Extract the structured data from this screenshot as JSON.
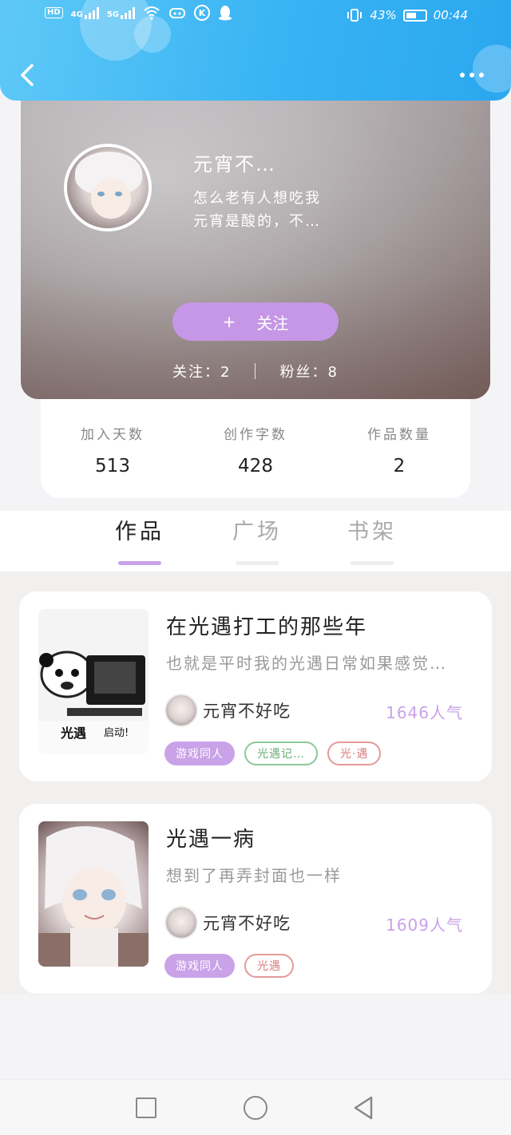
{
  "status_bar": {
    "left_tags": [
      "HD",
      "4G",
      "5G"
    ],
    "battery": "43%",
    "time": "00:44"
  },
  "header": {
    "back_icon": "chevron-left-icon",
    "more_icon": "more-horizontal-icon"
  },
  "profile": {
    "name": "元宵不…",
    "bio_line1": "怎么老有人想吃我",
    "bio_line2": "元宵是酸的，不…",
    "follow_plus": "+",
    "follow_label": "关注",
    "following_text": "关注：2",
    "fans_text": "粉丝：8"
  },
  "stats": [
    {
      "label": "加入天数",
      "value": "513"
    },
    {
      "label": "创作字数",
      "value": "428"
    },
    {
      "label": "作品数量",
      "value": "2"
    }
  ],
  "tabs": [
    {
      "label": "作品",
      "active": true
    },
    {
      "label": "广场",
      "active": false
    },
    {
      "label": "书架",
      "active": false
    }
  ],
  "works": [
    {
      "title": "在光遇打工的那些年",
      "desc": "也就是平时我的光遇日常如果感觉…",
      "author": "元宵不好吃",
      "popularity": "1646人气",
      "cover_text_left": "光遇",
      "cover_text_right": "启动!",
      "tags": [
        {
          "label": "游戏同人",
          "style": "purple"
        },
        {
          "label": "光遇记…",
          "style": "green"
        },
        {
          "label": "光·遇",
          "style": "red"
        }
      ]
    },
    {
      "title": "光遇一病",
      "desc": "想到了再弄封面也一样",
      "author": "元宵不好吃",
      "popularity": "1609人气",
      "tags": [
        {
          "label": "游戏同人",
          "style": "purple"
        },
        {
          "label": "光遇",
          "style": "red"
        }
      ]
    }
  ],
  "colors": {
    "header_blue": "#38b3f3",
    "accent_purple": "#c597e6",
    "tag_green": "#8dc79a",
    "tag_red": "#e49a9a"
  }
}
